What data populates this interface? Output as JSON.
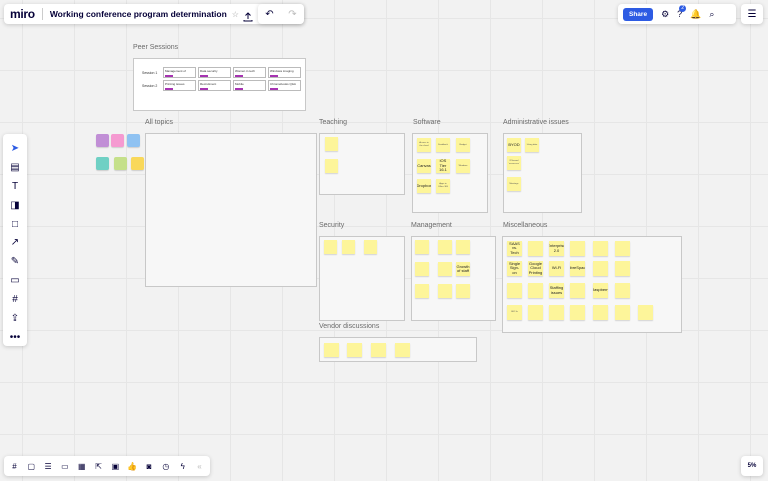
{
  "app": {
    "logo": "miro",
    "board_title": "Working conference program determination"
  },
  "toolbar": {
    "share_label": "Share",
    "notification_count": "2",
    "zoom": "5%"
  },
  "frames": {
    "peer_sessions": "Peer Sessions",
    "all_topics": "All topics",
    "teaching": "Teaching",
    "software": "Software",
    "admin": "Administrative issues",
    "security": "Security",
    "management": "Management",
    "misc": "Miscellaneous",
    "vendor": "Vendor discussions"
  },
  "peer_sessions": {
    "rows": [
      {
        "label": "Session 1",
        "cells": [
          "Management of",
          "Data security",
          "Women in tech",
          "Windows imaging"
        ]
      },
      {
        "label": "Session 2",
        "cells": [
          "Printing issues",
          "Recruitment",
          "Mobile",
          "Chromebooks Q&A"
        ]
      }
    ]
  },
  "stickies": {
    "software": [
      "Access in the cloud",
      "Feedback",
      "Budget",
      "Canvas",
      "iOS Tier 16.1",
      "Windows",
      "Dropbox",
      "Apps in Office 365"
    ],
    "admin": [
      "BYOD",
      "Using data",
      "IP-based 'no-access'",
      "Meetings"
    ],
    "misc": [
      "SAAS vs. Tech",
      "",
      "Enterprise 2.0",
      "",
      "",
      "",
      "Single Sign-on",
      "Google Cloud Printing",
      "Wi-Fi",
      "LibreSpace",
      "",
      "",
      "",
      "",
      "Staffing issues",
      "",
      "Raspberry",
      "",
      "802.1x",
      "",
      "",
      ""
    ],
    "management": [
      "",
      "",
      "",
      "",
      "",
      "Growth of staff",
      "",
      "",
      ""
    ]
  },
  "colors": {
    "accent": "#2d5be3",
    "sticky": "#fdf59a",
    "purple": "#a633b1"
  }
}
